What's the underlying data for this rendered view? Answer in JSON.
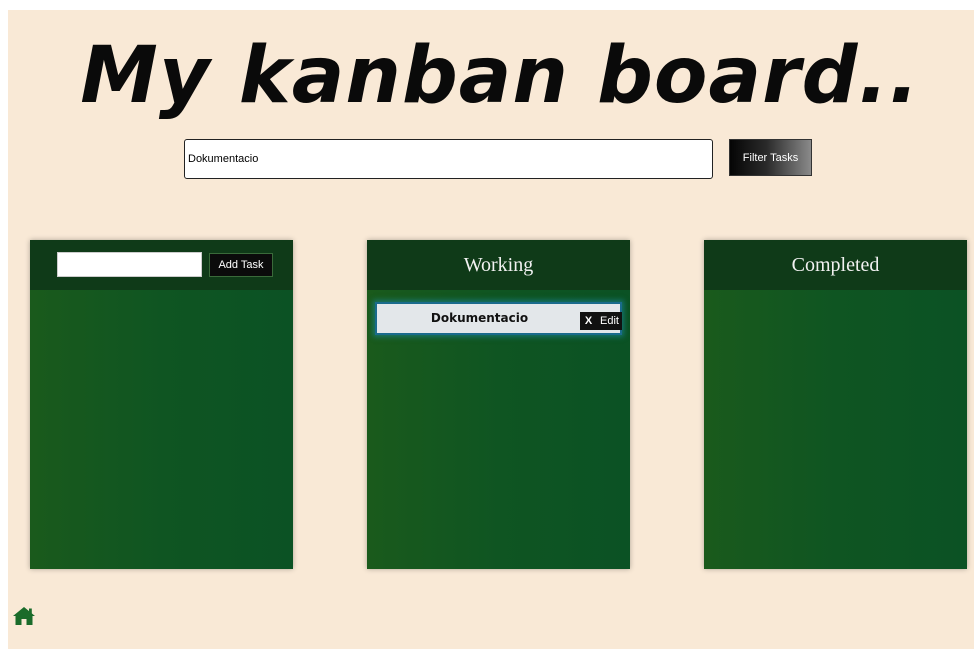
{
  "page": {
    "title": "My kanban board.."
  },
  "search": {
    "value": "Dokumentacio",
    "placeholder": "",
    "button_label": "Filter Tasks"
  },
  "columns": [
    {
      "title": "",
      "new_task": {
        "value": "",
        "button_label": "Add Task"
      },
      "tasks": []
    },
    {
      "title": "Working",
      "tasks": [
        {
          "text": "Dokumentacio",
          "delete_label": "X",
          "edit_label": "Edit"
        }
      ]
    },
    {
      "title": "Completed",
      "tasks": []
    }
  ],
  "footer": {
    "home_icon": "home-icon"
  },
  "colors": {
    "background": "#f9e9d6",
    "column_body": "#0f5522",
    "column_header": "#0f3a18",
    "task_card": "#e3e7ea",
    "task_glow": "#1e8caa",
    "home_icon": "#1a6b2a"
  }
}
